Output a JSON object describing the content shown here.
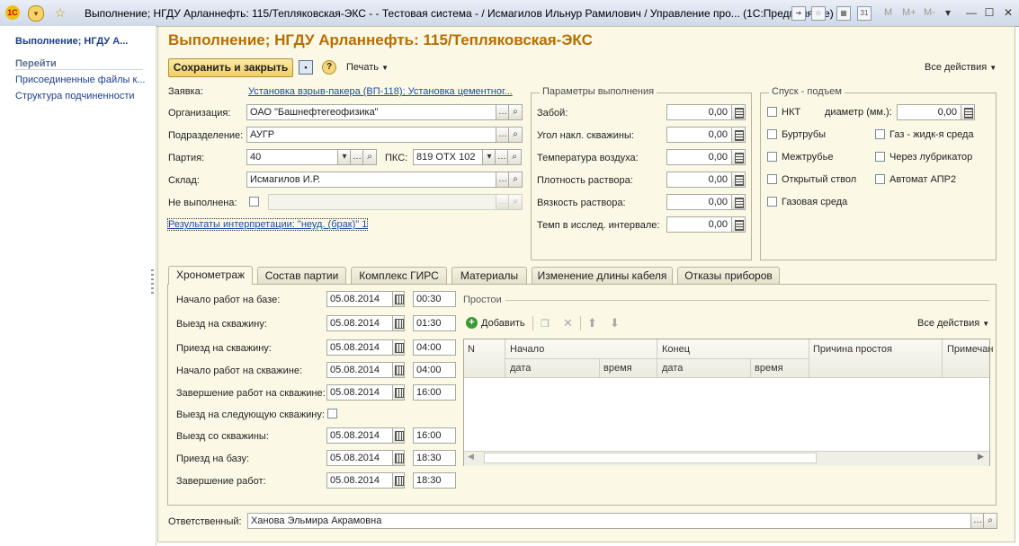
{
  "window": {
    "title": "Выполнение; НГДУ Арланнефть: 115/Тепляковская-ЭКС - - Тестовая система - / Исмагилов Ильнур Рамилович /  Управление про...  (1С:Предприятие)",
    "app_icon": "1С",
    "mem_buttons": [
      "M",
      "M+",
      "M-"
    ]
  },
  "left_panel": {
    "title": "Выполнение; НГДУ А...",
    "section": "Перейти",
    "items": [
      "Присоединенные файлы к...",
      "Структура подчиненности"
    ]
  },
  "form": {
    "title": "Выполнение; НГДУ Арланнефть: 115/Тепляковская-ЭКС",
    "toolbar": {
      "save_close": "Сохранить и закрыть",
      "print": "Печать",
      "all_actions": "Все действия"
    },
    "fields": {
      "request_label": "Заявка:",
      "request_value": "Установка взрыв-пакера (ВП-118); Установка цементног...",
      "org_label": "Организация:",
      "org_value": "ОАО \"Башнефтегеофизика\"",
      "division_label": "Подразделение:",
      "division_value": "АУГР",
      "party_label": "Партия:",
      "party_value": "40",
      "pks_label": "ПКС:",
      "pks_value": "819 ОТХ 102",
      "warehouse_label": "Склад:",
      "warehouse_value": "Исмагилов И.Р.",
      "not_done_label": "Не выполнена:",
      "interpretation_link": "Результаты интерпретации: \"неуд. (брак)\" 1"
    },
    "params": {
      "title": "Параметры выполнения",
      "rows": [
        {
          "label": "Забой:",
          "value": "0,00"
        },
        {
          "label": "Угол накл. скважины:",
          "value": "0,00"
        },
        {
          "label": "Температура воздуха:",
          "value": "0,00"
        },
        {
          "label": "Плотность раствора:",
          "value": "0,00"
        },
        {
          "label": "Вязкость раствора:",
          "value": "0,00"
        },
        {
          "label": "Темп в исслед. интервале:",
          "value": "0,00"
        }
      ]
    },
    "descent": {
      "title": "Спуск - подъем",
      "nkt": "НКТ",
      "diameter_label": "диаметр (мм.):",
      "diameter_value": "0,00",
      "checks": [
        "Буртрубы",
        "Газ - жидк-я среда",
        "Межтрубье",
        "Через лубрикатор",
        "Открытый ствол",
        "Автомат АПР2",
        "Газовая среда"
      ]
    },
    "tabs": [
      "Хронометраж",
      "Состав партии",
      "Комплекс ГИРС",
      "Материалы",
      "Изменение длины кабеля",
      "Отказы приборов"
    ],
    "chrono": [
      {
        "label": "Начало работ на базе:",
        "date": "05.08.2014",
        "time": "00:30"
      },
      {
        "label": "Выезд на скважину:",
        "date": "05.08.2014",
        "time": "01:30"
      },
      {
        "label": "Приезд на скважину:",
        "date": "05.08.2014",
        "time": "04:00"
      },
      {
        "label": "Начало работ на скважине:",
        "date": "05.08.2014",
        "time": "04:00"
      },
      {
        "label": "Завершение работ на скважине:",
        "date": "05.08.2014",
        "time": "16:00"
      },
      {
        "label": "Выезд на следующую скважину:"
      },
      {
        "label": "Выезд со скважины:",
        "date": "05.08.2014",
        "time": "16:00"
      },
      {
        "label": "Приезд на базу:",
        "date": "05.08.2014",
        "time": "18:30"
      },
      {
        "label": "Завершение работ:",
        "date": "05.08.2014",
        "time": "18:30"
      }
    ],
    "downtime": {
      "title": "Простои",
      "add": "Добавить",
      "all_actions": "Все действия",
      "headers": {
        "n": "N",
        "start": "Начало",
        "end": "Конец",
        "reason": "Причина простоя",
        "note": "Примечан",
        "date": "дата",
        "time": "время"
      }
    },
    "responsible_label": "Ответственный:",
    "responsible_value": "Ханова Эльмира Акрамовна"
  }
}
